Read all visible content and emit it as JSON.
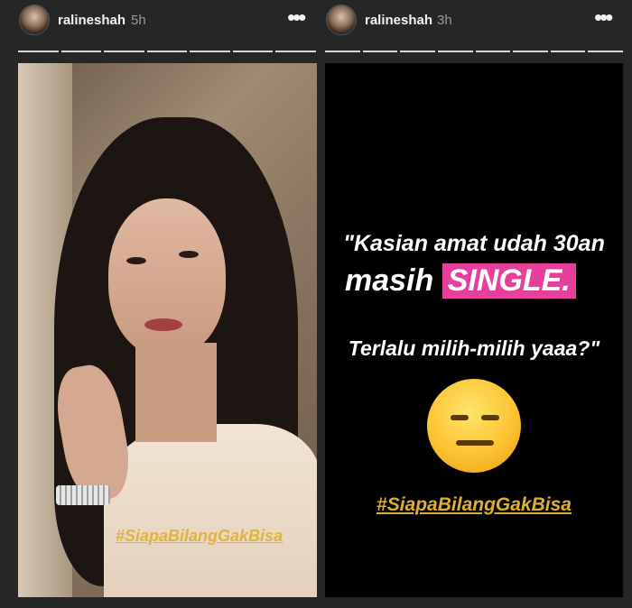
{
  "stories": [
    {
      "username": "ralineshah",
      "time": "5h",
      "more_icon": "more-horizontal-icon",
      "hashtag": "#SiapaBilangGakBisa"
    },
    {
      "username": "ralineshah",
      "time": "3h",
      "more_icon": "more-horizontal-icon",
      "quote_line1": "\"Kasian amat udah 30an",
      "quote_line2_prefix": "masih ",
      "quote_line2_highlight": "SINGLE.",
      "quote_line3": "Terlalu milih-milih yaaa?\"",
      "emoji": "expressionless-face-icon",
      "hashtag": "#SiapaBilangGakBisa"
    }
  ],
  "colors": {
    "background": "#262626",
    "highlight_pink": "#e6409c",
    "hashtag_gold": "#e0b02c"
  }
}
